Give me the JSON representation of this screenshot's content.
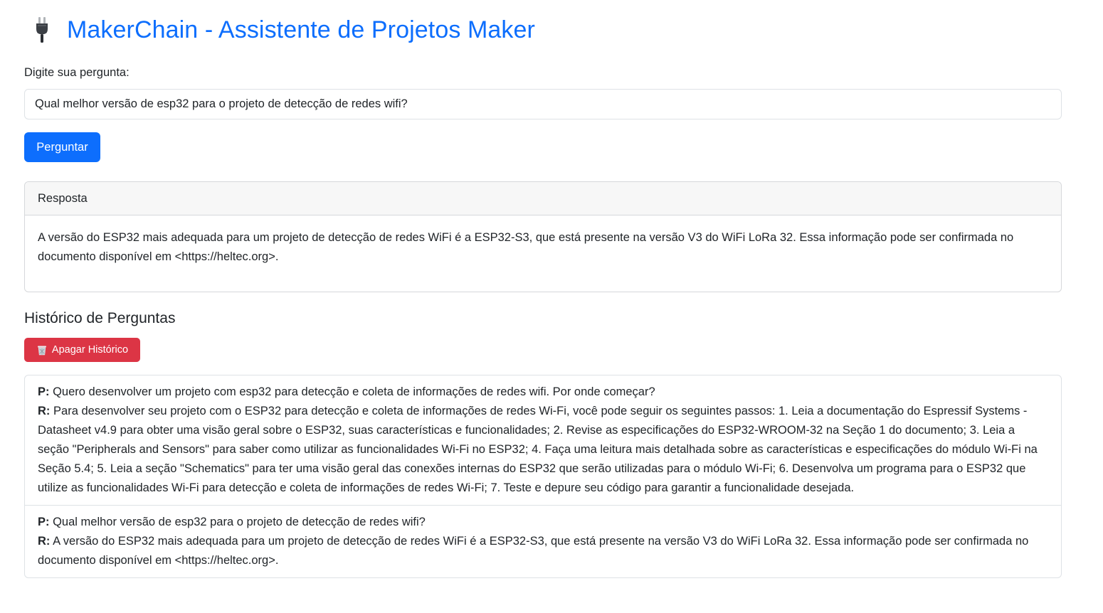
{
  "app": {
    "title": "MakerChain - Assistente de Projetos Maker",
    "title_icon": "electric-plug-icon",
    "accent_color": "#0d6efd"
  },
  "question_form": {
    "label": "Digite sua pergunta:",
    "input_value": "Qual melhor versão de esp32 para o projeto de detecção de redes wifi?",
    "submit_label": "Perguntar"
  },
  "answer": {
    "header": "Resposta",
    "body": "A versão do ESP32 mais adequada para um projeto de detecção de redes WiFi é a ESP32-S3, que está presente na versão V3 do WiFi LoRa 32. Essa informação pode ser confirmada no documento disponível em <https://heltec.org>."
  },
  "history": {
    "title": "Histórico de Perguntas",
    "clear_label": "Apagar Histórico",
    "clear_icon": "wastebasket-icon",
    "clear_color": "#dc3545",
    "question_prefix": "P:",
    "answer_prefix": "R:",
    "items": [
      {
        "question": "Quero desenvolver um projeto com esp32 para detecção e coleta de informações de redes wifi. Por onde começar?",
        "answer": "Para desenvolver seu projeto com o ESP32 para detecção e coleta de informações de redes Wi-Fi, você pode seguir os seguintes passos: 1. Leia a documentação do Espressif Systems - Datasheet v4.9 para obter uma visão geral sobre o ESP32, suas características e funcionalidades; 2. Revise as especificações do ESP32-WROOM-32 na Seção 1 do documento; 3. Leia a seção \"Peripherals and Sensors\" para saber como utilizar as funcionalidades Wi-Fi no ESP32; 4. Faça uma leitura mais detalhada sobre as características e especificações do módulo Wi-Fi na Seção 5.4; 5. Leia a seção \"Schematics\" para ter uma visão geral das conexões internas do ESP32 que serão utilizadas para o módulo Wi-Fi; 6. Desenvolva um programa para o ESP32 que utilize as funcionalidades Wi-Fi para detecção e coleta de informações de redes Wi-Fi; 7. Teste e depure seu código para garantir a funcionalidade desejada."
      },
      {
        "question": "Qual melhor versão de esp32 para o projeto de detecção de redes wifi?",
        "answer": "A versão do ESP32 mais adequada para um projeto de detecção de redes WiFi é a ESP32-S3, que está presente na versão V3 do WiFi LoRa 32. Essa informação pode ser confirmada no documento disponível em <https://heltec.org>."
      }
    ]
  }
}
